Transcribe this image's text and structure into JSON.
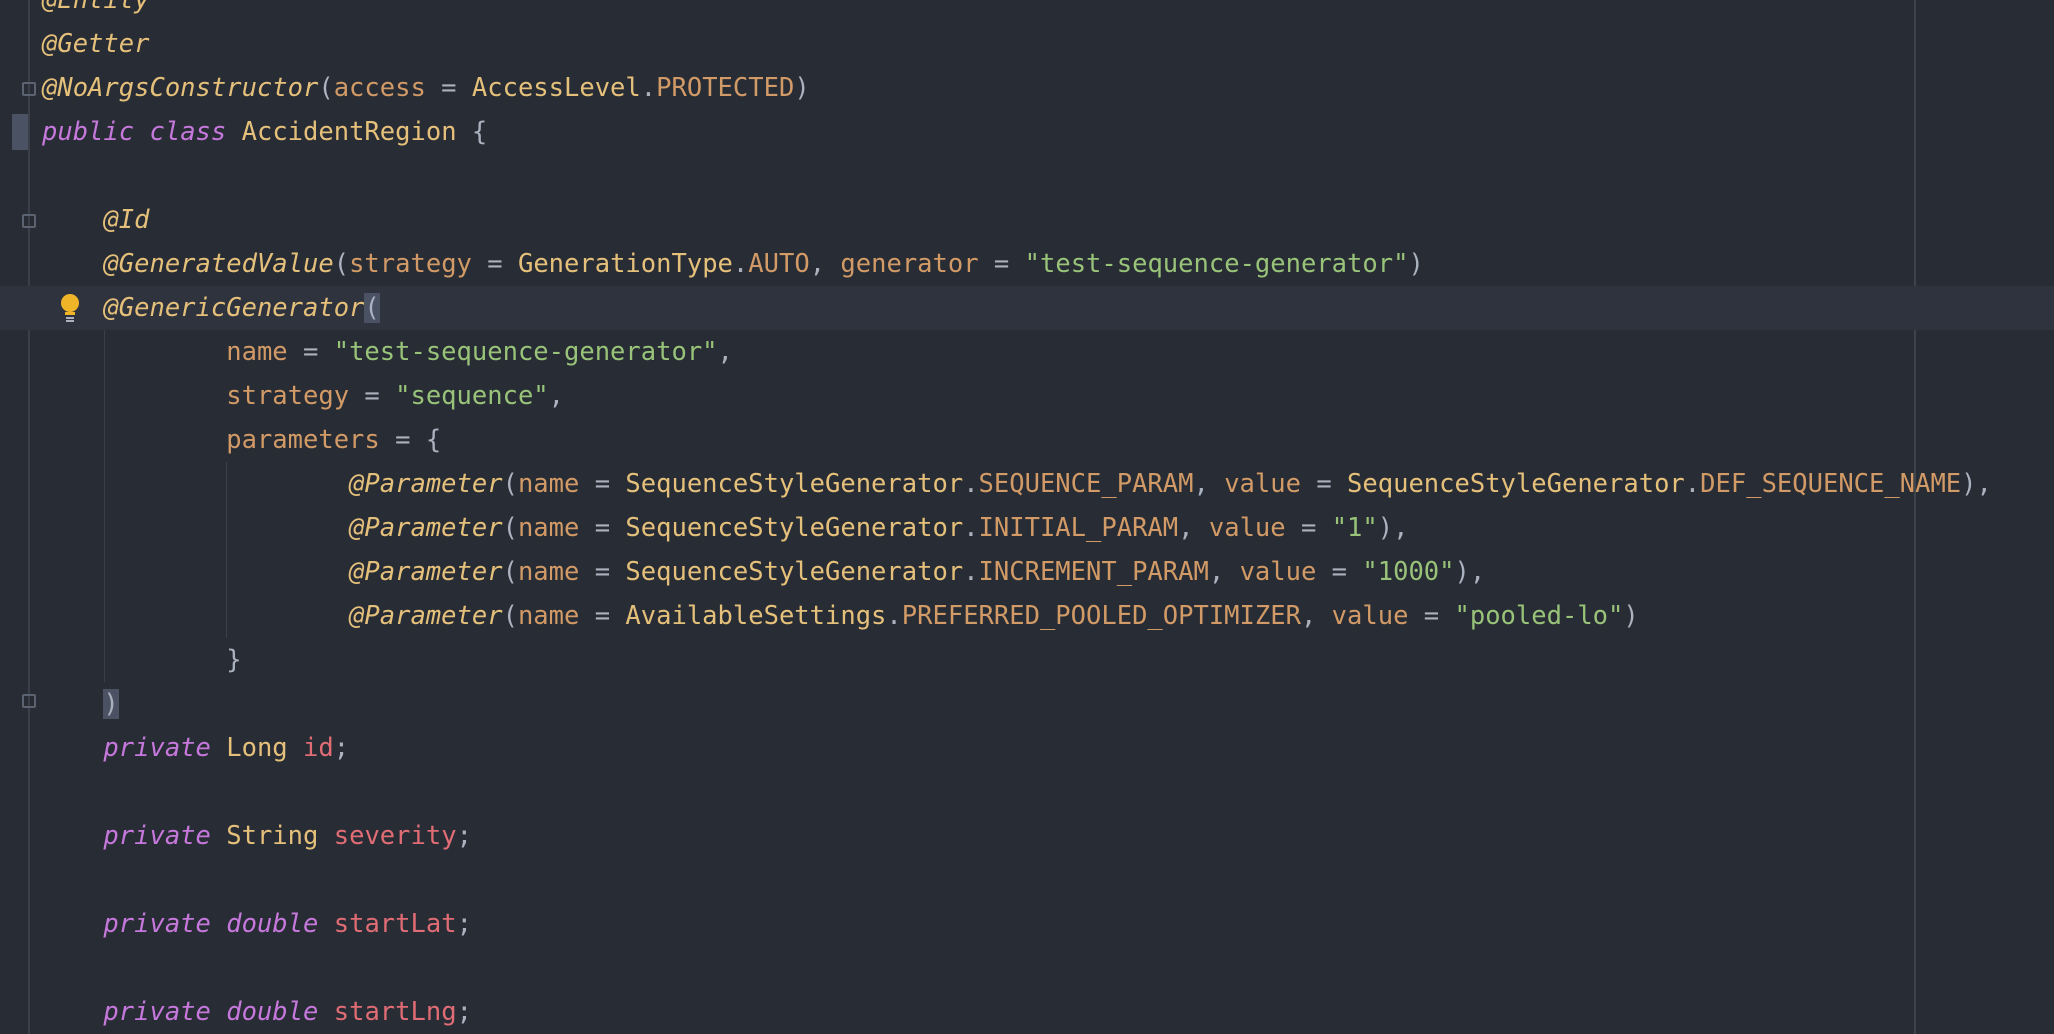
{
  "editor": {
    "language": "Java",
    "theme": {
      "background": "#282c34",
      "current_line": "#2f333d",
      "annotation": "#e5c07b",
      "keyword": "#c678dd",
      "string": "#98c379",
      "field": "#e06c75",
      "constant": "#d19a66",
      "plain": "#abb2bf"
    },
    "gutter_icons": [
      "fold-icon",
      "bookmark-icon",
      "lightbulb-icon"
    ],
    "lines": [
      {
        "id": "l0",
        "tokens": [
          [
            "ann",
            "@Entity"
          ]
        ]
      },
      {
        "id": "l1",
        "tokens": [
          [
            "ann",
            "@Getter"
          ]
        ]
      },
      {
        "id": "l2",
        "tokens": [
          [
            "ann",
            "@NoArgsConstructor"
          ],
          [
            "plain",
            "("
          ],
          [
            "param",
            "access"
          ],
          [
            "plain",
            " = "
          ],
          [
            "type",
            "AccessLevel"
          ],
          [
            "plain",
            "."
          ],
          [
            "const",
            "PROTECTED"
          ],
          [
            "plain",
            ")"
          ]
        ]
      },
      {
        "id": "l3",
        "tokens": [
          [
            "kw",
            "public"
          ],
          [
            "plain",
            " "
          ],
          [
            "kw",
            "class"
          ],
          [
            "plain",
            " "
          ],
          [
            "type",
            "AccidentRegion"
          ],
          [
            "plain",
            " {"
          ]
        ]
      },
      {
        "id": "l4",
        "tokens": []
      },
      {
        "id": "l5",
        "tokens": [
          [
            "plain",
            "    "
          ],
          [
            "ann",
            "@Id"
          ]
        ]
      },
      {
        "id": "l6",
        "tokens": [
          [
            "plain",
            "    "
          ],
          [
            "ann",
            "@GeneratedValue"
          ],
          [
            "plain",
            "("
          ],
          [
            "param",
            "strategy"
          ],
          [
            "plain",
            " = "
          ],
          [
            "type",
            "GenerationType"
          ],
          [
            "plain",
            "."
          ],
          [
            "const",
            "AUTO"
          ],
          [
            "plain",
            ", "
          ],
          [
            "param",
            "generator"
          ],
          [
            "plain",
            " = "
          ],
          [
            "str",
            "\"test-sequence-generator\""
          ],
          [
            "plain",
            ")"
          ]
        ]
      },
      {
        "id": "l7",
        "tokens": [
          [
            "plain",
            "    "
          ],
          [
            "ann",
            "@GenericGenerator"
          ],
          [
            "bracket",
            "("
          ]
        ]
      },
      {
        "id": "l8",
        "tokens": [
          [
            "plain",
            "            "
          ],
          [
            "param",
            "name"
          ],
          [
            "plain",
            " = "
          ],
          [
            "str",
            "\"test-sequence-generator\""
          ],
          [
            "plain",
            ","
          ]
        ]
      },
      {
        "id": "l9",
        "tokens": [
          [
            "plain",
            "            "
          ],
          [
            "param",
            "strategy"
          ],
          [
            "plain",
            " = "
          ],
          [
            "str",
            "\"sequence\""
          ],
          [
            "plain",
            ","
          ]
        ]
      },
      {
        "id": "l10",
        "tokens": [
          [
            "plain",
            "            "
          ],
          [
            "param",
            "parameters"
          ],
          [
            "plain",
            " = {"
          ]
        ]
      },
      {
        "id": "l11",
        "tokens": [
          [
            "plain",
            "                    "
          ],
          [
            "ann",
            "@Parameter"
          ],
          [
            "plain",
            "("
          ],
          [
            "param",
            "name"
          ],
          [
            "plain",
            " = "
          ],
          [
            "type",
            "SequenceStyleGenerator"
          ],
          [
            "plain",
            "."
          ],
          [
            "const",
            "SEQUENCE_PARAM"
          ],
          [
            "plain",
            ", "
          ],
          [
            "param",
            "value"
          ],
          [
            "plain",
            " = "
          ],
          [
            "type",
            "SequenceStyleGenerator"
          ],
          [
            "plain",
            "."
          ],
          [
            "const",
            "DEF_SEQUENCE_NAME"
          ],
          [
            "plain",
            "),"
          ]
        ]
      },
      {
        "id": "l12",
        "tokens": [
          [
            "plain",
            "                    "
          ],
          [
            "ann",
            "@Parameter"
          ],
          [
            "plain",
            "("
          ],
          [
            "param",
            "name"
          ],
          [
            "plain",
            " = "
          ],
          [
            "type",
            "SequenceStyleGenerator"
          ],
          [
            "plain",
            "."
          ],
          [
            "const",
            "INITIAL_PARAM"
          ],
          [
            "plain",
            ", "
          ],
          [
            "param",
            "value"
          ],
          [
            "plain",
            " = "
          ],
          [
            "str",
            "\"1\""
          ],
          [
            "plain",
            "),"
          ]
        ]
      },
      {
        "id": "l13",
        "tokens": [
          [
            "plain",
            "                    "
          ],
          [
            "ann",
            "@Parameter"
          ],
          [
            "plain",
            "("
          ],
          [
            "param",
            "name"
          ],
          [
            "plain",
            " = "
          ],
          [
            "type",
            "SequenceStyleGenerator"
          ],
          [
            "plain",
            "."
          ],
          [
            "const",
            "INCREMENT_PARAM"
          ],
          [
            "plain",
            ", "
          ],
          [
            "param",
            "value"
          ],
          [
            "plain",
            " = "
          ],
          [
            "str",
            "\"1000\""
          ],
          [
            "plain",
            "),"
          ]
        ]
      },
      {
        "id": "l14",
        "tokens": [
          [
            "plain",
            "                    "
          ],
          [
            "ann",
            "@Parameter"
          ],
          [
            "plain",
            "("
          ],
          [
            "param",
            "name"
          ],
          [
            "plain",
            " = "
          ],
          [
            "type",
            "AvailableSettings"
          ],
          [
            "plain",
            "."
          ],
          [
            "const",
            "PREFERRED_POOLED_OPTIMIZER"
          ],
          [
            "plain",
            ", "
          ],
          [
            "param",
            "value"
          ],
          [
            "plain",
            " = "
          ],
          [
            "str",
            "\"pooled-lo\""
          ],
          [
            "plain",
            ")"
          ]
        ]
      },
      {
        "id": "l15",
        "tokens": [
          [
            "plain",
            "            }"
          ]
        ]
      },
      {
        "id": "l16",
        "tokens": [
          [
            "plain",
            "    "
          ],
          [
            "bracket",
            ")"
          ]
        ]
      },
      {
        "id": "l17",
        "tokens": [
          [
            "plain",
            "    "
          ],
          [
            "kw",
            "private"
          ],
          [
            "plain",
            " "
          ],
          [
            "type",
            "Long"
          ],
          [
            "plain",
            " "
          ],
          [
            "field",
            "id"
          ],
          [
            "plain",
            ";"
          ]
        ]
      },
      {
        "id": "l18",
        "tokens": []
      },
      {
        "id": "l19",
        "tokens": [
          [
            "plain",
            "    "
          ],
          [
            "kw",
            "private"
          ],
          [
            "plain",
            " "
          ],
          [
            "type",
            "String"
          ],
          [
            "plain",
            " "
          ],
          [
            "field",
            "severity"
          ],
          [
            "plain",
            ";"
          ]
        ]
      },
      {
        "id": "l20",
        "tokens": []
      },
      {
        "id": "l21",
        "tokens": [
          [
            "plain",
            "    "
          ],
          [
            "kw",
            "private"
          ],
          [
            "plain",
            " "
          ],
          [
            "kw",
            "double"
          ],
          [
            "plain",
            " "
          ],
          [
            "field",
            "startLat"
          ],
          [
            "plain",
            ";"
          ]
        ]
      },
      {
        "id": "l22",
        "tokens": []
      },
      {
        "id": "l23",
        "tokens": [
          [
            "plain",
            "    "
          ],
          [
            "kw",
            "private"
          ],
          [
            "plain",
            " "
          ],
          [
            "kw",
            "double"
          ],
          [
            "plain",
            " "
          ],
          [
            "field",
            "startLng"
          ],
          [
            "plain",
            ";"
          ]
        ]
      }
    ]
  }
}
